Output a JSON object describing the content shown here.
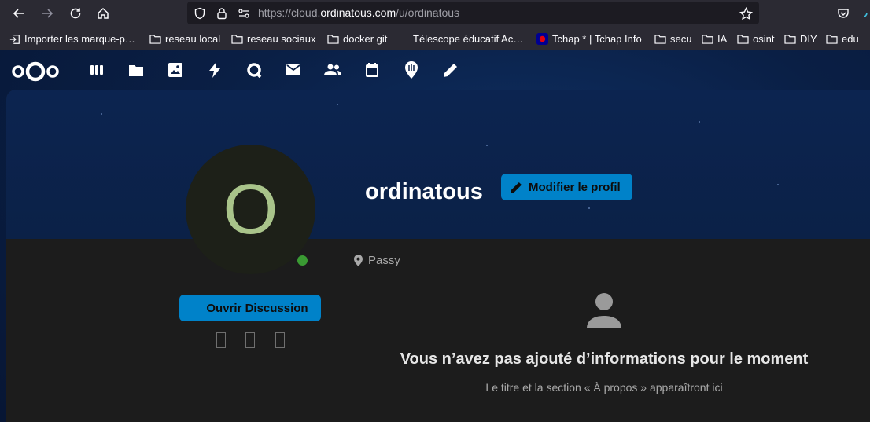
{
  "browser": {
    "url_prefix": "https://cloud.",
    "url_domain": "ordinatous.com",
    "url_path": "/u/ordinatous"
  },
  "bookmarks": [
    {
      "label": "Importer les marque-p…",
      "icon": "import-icon"
    },
    {
      "label": "reseau local",
      "icon": "folder-icon"
    },
    {
      "label": "reseau sociaux",
      "icon": "folder-icon"
    },
    {
      "label": "docker git",
      "icon": "folder-icon"
    },
    {
      "label": "Télescope éducatif Ac…",
      "icon": "none"
    },
    {
      "label": "Tchap * | Tchap Info",
      "icon": "tchap-icon"
    },
    {
      "label": "secu",
      "icon": "folder-icon"
    },
    {
      "label": "IA",
      "icon": "folder-icon"
    },
    {
      "label": "osint",
      "icon": "folder-icon"
    },
    {
      "label": "DIY",
      "icon": "folder-icon"
    },
    {
      "label": "edu",
      "icon": "folder-icon"
    }
  ],
  "nextcloud": {
    "apps": [
      "dashboard-icon",
      "files-icon",
      "photos-icon",
      "activity-icon",
      "talk-icon",
      "mail-icon",
      "contacts-icon",
      "calendar-icon",
      "maps-icon",
      "notes-icon"
    ]
  },
  "profile": {
    "avatar_letter": "O",
    "username": "ordinatous",
    "edit_label": "Modifier le profil",
    "location": "Passy",
    "chat_label": "Ouvrir Discussion",
    "status": "online",
    "empty_title": "Vous n’avez pas ajouté d’informations pour le moment",
    "empty_desc": "Le titre et la section « À propos » apparaîtront ici"
  },
  "colors": {
    "primary": "#0082c9",
    "status_online": "#3a9a33",
    "avatar_text": "#a9c48a"
  }
}
